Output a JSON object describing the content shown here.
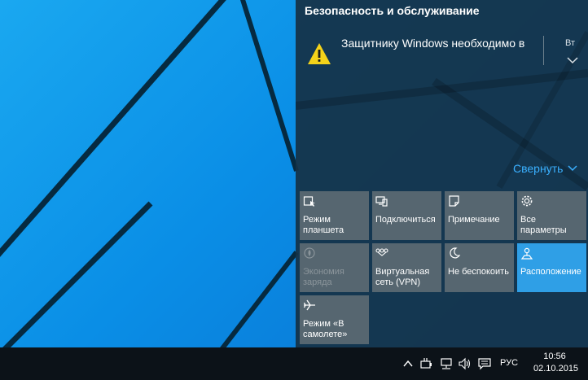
{
  "action_center": {
    "notification_group_title": "Безопасность и обслуживание",
    "notification": {
      "text": "Защитнику Windows необходимо в",
      "time": "Вт",
      "icon": "warning-icon",
      "icon_color": "#f5d31a"
    },
    "collapse_label": "Свернуть",
    "accent_color": "#3ab0ff"
  },
  "quick_actions": [
    {
      "label": "Режим планшета",
      "icon": "tablet-mode-icon",
      "state": "off"
    },
    {
      "label": "Подключиться",
      "icon": "connect-icon",
      "state": "off"
    },
    {
      "label": "Примечание",
      "icon": "note-icon",
      "state": "off"
    },
    {
      "label": "Все параметры",
      "icon": "gear-icon",
      "state": "off"
    },
    {
      "label": "Экономия заряда",
      "icon": "battery-saver-icon",
      "state": "disabled"
    },
    {
      "label": "Виртуальная сеть (VPN)",
      "icon": "vpn-icon",
      "state": "off"
    },
    {
      "label": "Не беспокоить",
      "icon": "moon-icon",
      "state": "off"
    },
    {
      "label": "Расположение",
      "icon": "location-icon",
      "state": "on"
    },
    {
      "label": "Режим «В самолете»",
      "icon": "airplane-icon",
      "state": "off"
    }
  ],
  "taskbar": {
    "language": "РУС",
    "time": "10:56",
    "date": "02.10.2015",
    "tray_icons": [
      "chevron-up-icon",
      "power-icon",
      "network-icon",
      "volume-icon",
      "action-center-icon"
    ]
  }
}
